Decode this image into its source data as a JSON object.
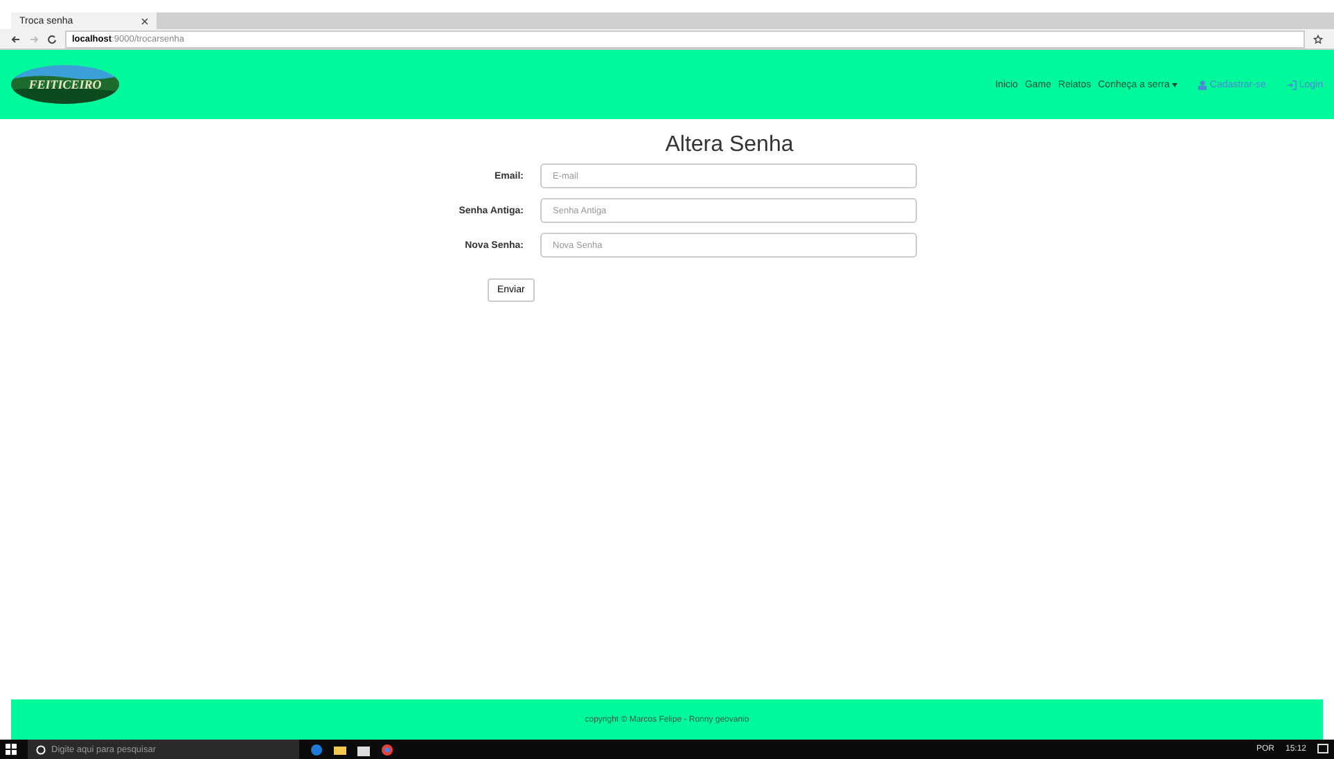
{
  "browser": {
    "tab_title": "Troca senha",
    "url_host": "localhost",
    "url_path": ":9000/trocarsenha"
  },
  "header": {
    "logo": "FEITICEIRO",
    "nav": [
      {
        "label": "Inicio",
        "kind": "link"
      },
      {
        "label": "Game",
        "kind": "link"
      },
      {
        "label": "Relatos",
        "kind": "link"
      },
      {
        "label": "Conheça a serra",
        "kind": "dropdown"
      },
      {
        "label": "Cadastrar-se",
        "kind": "user"
      },
      {
        "label": "Login",
        "kind": "login"
      }
    ]
  },
  "form": {
    "title": "Altera Senha",
    "fields": [
      {
        "label": "Email:",
        "placeholder": "E-mail"
      },
      {
        "label": "Senha Antiga:",
        "placeholder": "Senha Antiga"
      },
      {
        "label": "Nova Senha:",
        "placeholder": "Nova Senha"
      }
    ],
    "submit": "Enviar"
  },
  "footer": {
    "text": "copyright © Marcos Felipe - Ronny geovanio"
  },
  "taskbar": {
    "search_placeholder": "Digite aqui para pesquisar",
    "language": "POR",
    "time": "15:12"
  }
}
